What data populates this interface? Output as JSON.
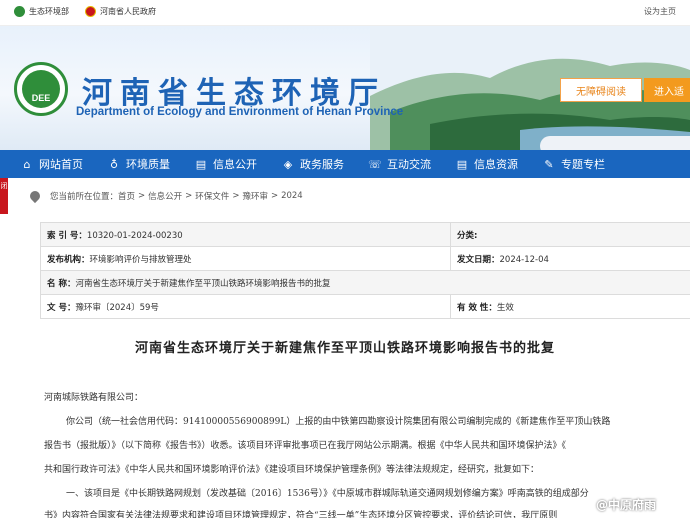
{
  "topbar": {
    "links": [
      {
        "label": "生态环境部"
      },
      {
        "label": "河南省人民政府"
      }
    ],
    "right": "设为主页"
  },
  "header": {
    "logo_text": "DEE",
    "title": "河南省生态环境厅",
    "subtitle": "Department of Ecology and Environment of Henan Province",
    "accessible_button": "无障碍阅读",
    "old_button": "进入适"
  },
  "nav": {
    "items": [
      {
        "label": "网站首页",
        "icon": "home-icon",
        "glyph": "⌂"
      },
      {
        "label": "环境质量",
        "icon": "people-icon",
        "glyph": "♁"
      },
      {
        "label": "信息公开",
        "icon": "document-icon",
        "glyph": "▤"
      },
      {
        "label": "政务服务",
        "icon": "layers-icon",
        "glyph": "◈"
      },
      {
        "label": "互动交流",
        "icon": "chat-icon",
        "glyph": "☏"
      },
      {
        "label": "信息资源",
        "icon": "document-icon",
        "glyph": "▤"
      },
      {
        "label": "专题专栏",
        "icon": "pencil-icon",
        "glyph": "✎"
      }
    ]
  },
  "side_tab": "闭",
  "breadcrumb": {
    "prefix": "您当前所在位置：",
    "items": [
      "首页",
      "信息公开",
      "环保文件",
      "豫环审",
      "2024"
    ],
    "separator": ">"
  },
  "meta": {
    "index_label": "索 引 号：",
    "index_value": "10320-01-2024-00230",
    "category_label": "分类:",
    "category_value": "",
    "publisher_label": "发布机构：",
    "publisher_value": "环境影响评价与排放管理处",
    "date_label": "发文日期：",
    "date_value": "2024-12-04",
    "name_label": "名      称：",
    "name_value": "河南省生态环境厅关于新建焦作至平顶山铁路环境影响报告书的批复",
    "docno_label": "文      号：",
    "docno_value": "豫环审〔2024〕59号",
    "validity_label": "有 效 性：",
    "validity_value": "生效"
  },
  "doc": {
    "title": "河南省生态环境厅关于新建焦作至平顶山铁路环境影响报告书的批复",
    "addressee": "河南城际铁路有限公司：",
    "lines": [
      "你公司（统一社会信用代码：91410000556900899L）上报的由中铁第四勘察设计院集团有限公司编制完成的《新建焦作至平顶山铁路",
      "报告书（报批版）》（以下简称《报告书》）收悉。该项目环评审批事项已在我厅网站公示期满。根据《中华人民共和国环境保护法》《",
      "共和国行政许可法》《中华人民共和国环境影响评价法》《建设项目环境保护管理条例》等法律法规规定，经研究，批复如下：",
      "一、该项目是《中长期铁路网规划（发改基础〔2016〕1536号）》《中原城市群城际轨道交通网规划修编方案》呼南高铁的组成部分",
      "书》内容符合国家有关法律法规要求和建设项目环境管理规定，符合“三线一单”生态环境分区管控要求，评价结论可信，我厅原则"
    ]
  },
  "watermark": "@中原府雨"
}
